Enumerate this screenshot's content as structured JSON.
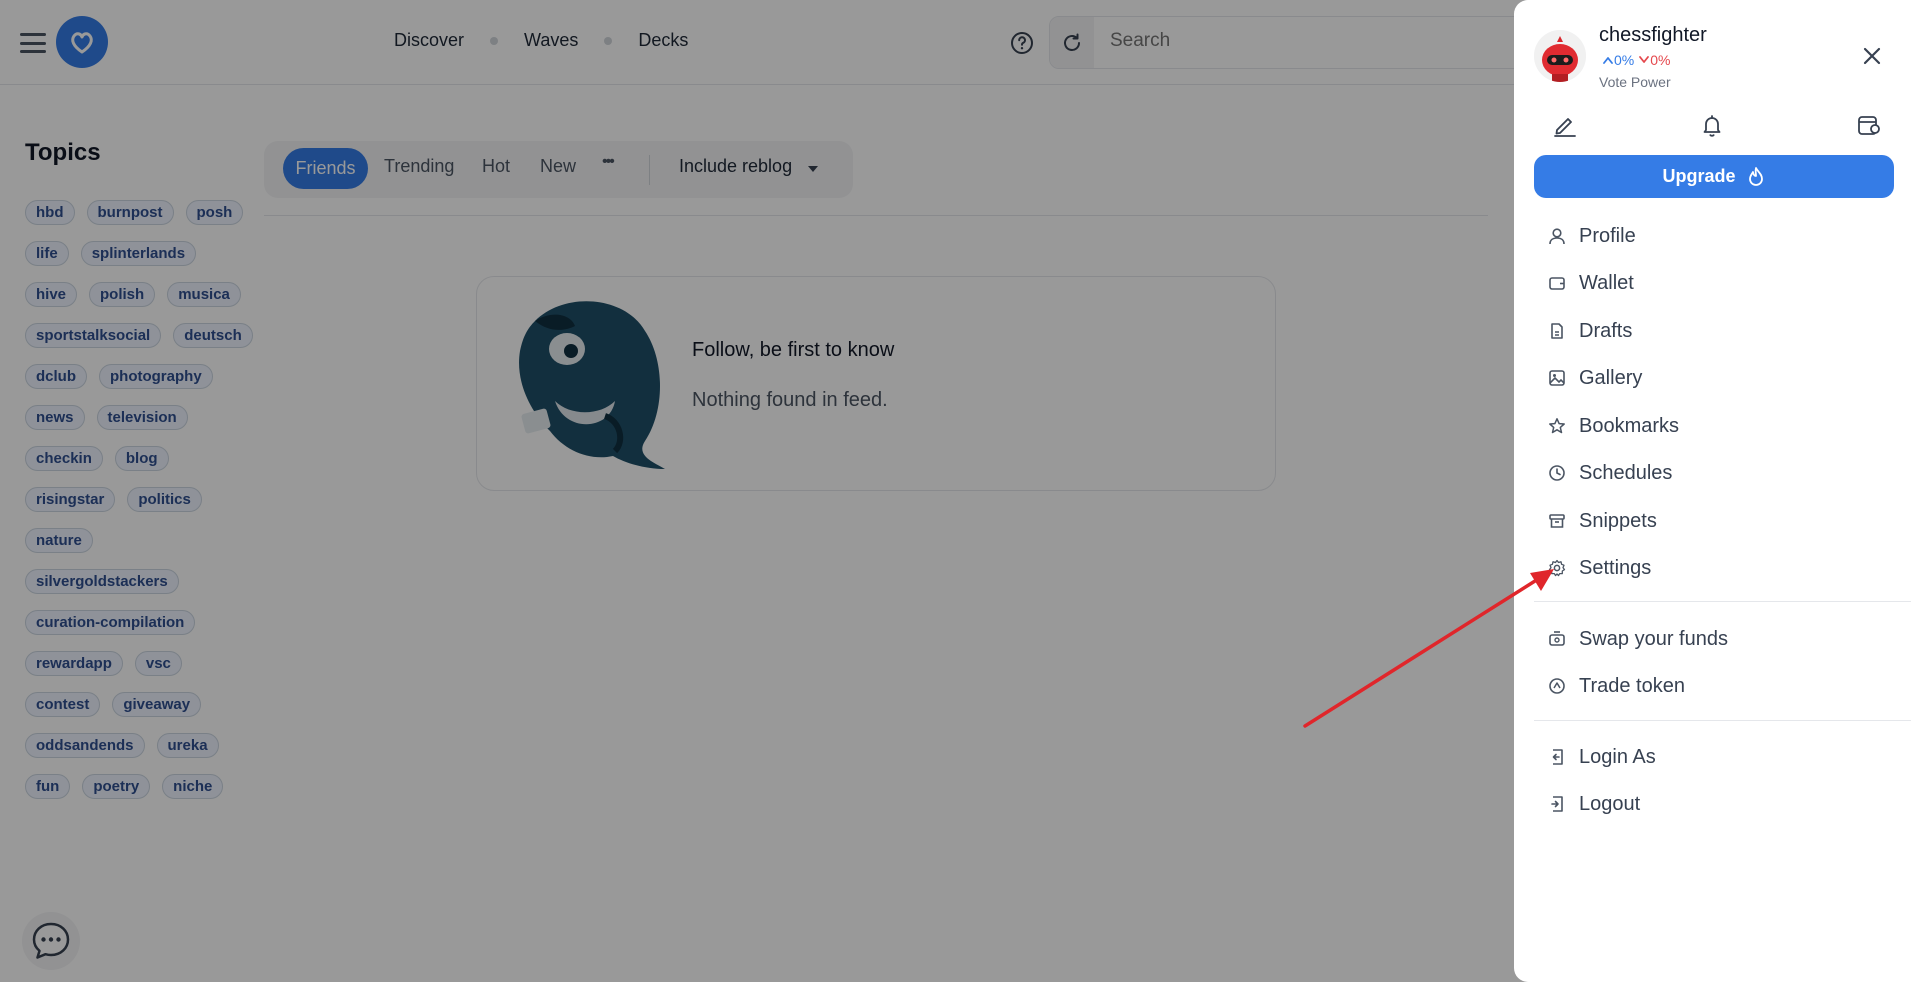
{
  "header": {
    "nav": [
      "Discover",
      "Waves",
      "Decks"
    ],
    "search_placeholder": "Search"
  },
  "sidebar": {
    "title": "Topics",
    "tags": [
      "hbd",
      "burnpost",
      "posh",
      "life",
      "splinterlands",
      "hive",
      "polish",
      "musica",
      "sportstalksocial",
      "deutsch",
      "dclub",
      "photography",
      "news",
      "television",
      "checkin",
      "blog",
      "risingstar",
      "politics",
      "nature",
      "silvergoldstackers",
      "curation-compilation",
      "rewardapp",
      "vsc",
      "contest",
      "giveaway",
      "oddsandends",
      "ureka",
      "fun",
      "poetry",
      "niche"
    ]
  },
  "feed": {
    "tabs": {
      "friends": "Friends",
      "trending": "Trending",
      "hot": "Hot",
      "new": "New"
    },
    "more_label": "•••",
    "reblog_filter": "Include reblog",
    "empty_title": "Follow, be first to know",
    "empty_subtitle": "Nothing found in feed."
  },
  "drawer": {
    "username": "chessfighter",
    "vote_up": "0%",
    "vote_down": "0%",
    "vote_label": "Vote Power",
    "upgrade_label": "Upgrade",
    "menu_main": [
      "Profile",
      "Wallet",
      "Drafts",
      "Gallery",
      "Bookmarks",
      "Schedules",
      "Snippets",
      "Settings"
    ],
    "menu_funds": [
      "Swap your funds",
      "Trade token"
    ],
    "menu_account": [
      "Login As",
      "Logout"
    ]
  },
  "colors": {
    "accent": "#357ce6",
    "down": "#e5484d",
    "annotation_arrow": "#e0262b"
  }
}
